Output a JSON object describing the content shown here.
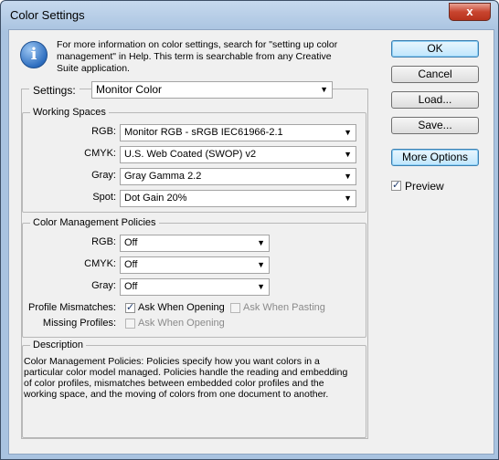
{
  "window": {
    "title": "Color Settings",
    "close_glyph": "x"
  },
  "info": {
    "icon": "info-icon",
    "text": "For more information on color settings, search for \"setting up color management\" in Help. This term is searchable from any Creative Suite application."
  },
  "buttons": {
    "ok": "OK",
    "cancel": "Cancel",
    "load": "Load...",
    "save": "Save...",
    "more_options": "More Options"
  },
  "preview": {
    "label": "Preview",
    "checked": true
  },
  "settings": {
    "label": "Settings:",
    "value": "Monitor Color"
  },
  "working_spaces": {
    "title": "Working Spaces",
    "rows": [
      {
        "label": "RGB:",
        "value": "Monitor RGB - sRGB IEC61966-2.1"
      },
      {
        "label": "CMYK:",
        "value": "U.S. Web Coated (SWOP) v2"
      },
      {
        "label": "Gray:",
        "value": "Gray Gamma 2.2"
      },
      {
        "label": "Spot:",
        "value": "Dot Gain 20%"
      }
    ]
  },
  "policies": {
    "title": "Color Management Policies",
    "rows": [
      {
        "label": "RGB:",
        "value": "Off"
      },
      {
        "label": "CMYK:",
        "value": "Off"
      },
      {
        "label": "Gray:",
        "value": "Off"
      }
    ],
    "profile_mismatches": {
      "label": "Profile Mismatches:",
      "ask_opening": "Ask When Opening",
      "ask_opening_checked": true,
      "ask_pasting": "Ask When Pasting",
      "ask_pasting_checked": false
    },
    "missing_profiles": {
      "label": "Missing Profiles:",
      "ask_opening": "Ask When Opening",
      "ask_opening_checked": false
    }
  },
  "description": {
    "title": "Description",
    "text": "Color Management Policies:  Policies specify how you want colors in a particular color model managed.  Policies handle the reading and embedding of color profiles, mismatches between embedded color profiles and the working space, and the moving of colors from one document to another."
  },
  "colors": {
    "accent": "#3c7fb1",
    "frame": "#a9c3e0",
    "close": "#c8452f"
  }
}
